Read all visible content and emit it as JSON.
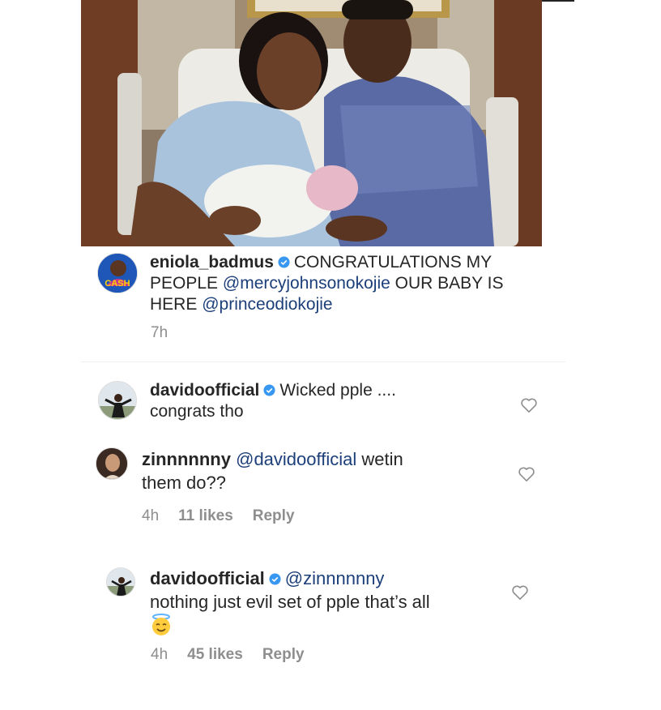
{
  "post": {
    "photo_alt": "hospital-photo",
    "caption": {
      "username": "eniola_badmus",
      "text_1": "CONGRATULATIONS MY",
      "text_2": "PEOPLE",
      "mention_1": "@mercyjohnsonokojie",
      "text_3": "OUR BABY IS",
      "text_4": "HERE",
      "mention_2": "@princeodiokojie",
      "time": "7h",
      "avatar_text": "CASH"
    }
  },
  "comments": [
    {
      "username": "davidoofficial",
      "line_1": "Wicked pple ....",
      "line_2": "congrats tho"
    },
    {
      "username": "zinnnnnny",
      "mention": "@davidoofficial",
      "line_1": "wetin",
      "line_2": "them do??",
      "time": "4h",
      "likes": "11 likes",
      "reply": "Reply"
    },
    {
      "username": "davidoofficial",
      "mention": "@zinnnnnny",
      "line_1": "nothing just evil set of pple that’s all",
      "emoji": "smiling-face-with-halo",
      "time": "4h",
      "likes": "45 likes",
      "reply": "Reply"
    }
  ],
  "colors": {
    "text": "#262626",
    "mention": "#1c3f7a",
    "meta": "#8e8e8e",
    "verified": "#3897f0"
  }
}
